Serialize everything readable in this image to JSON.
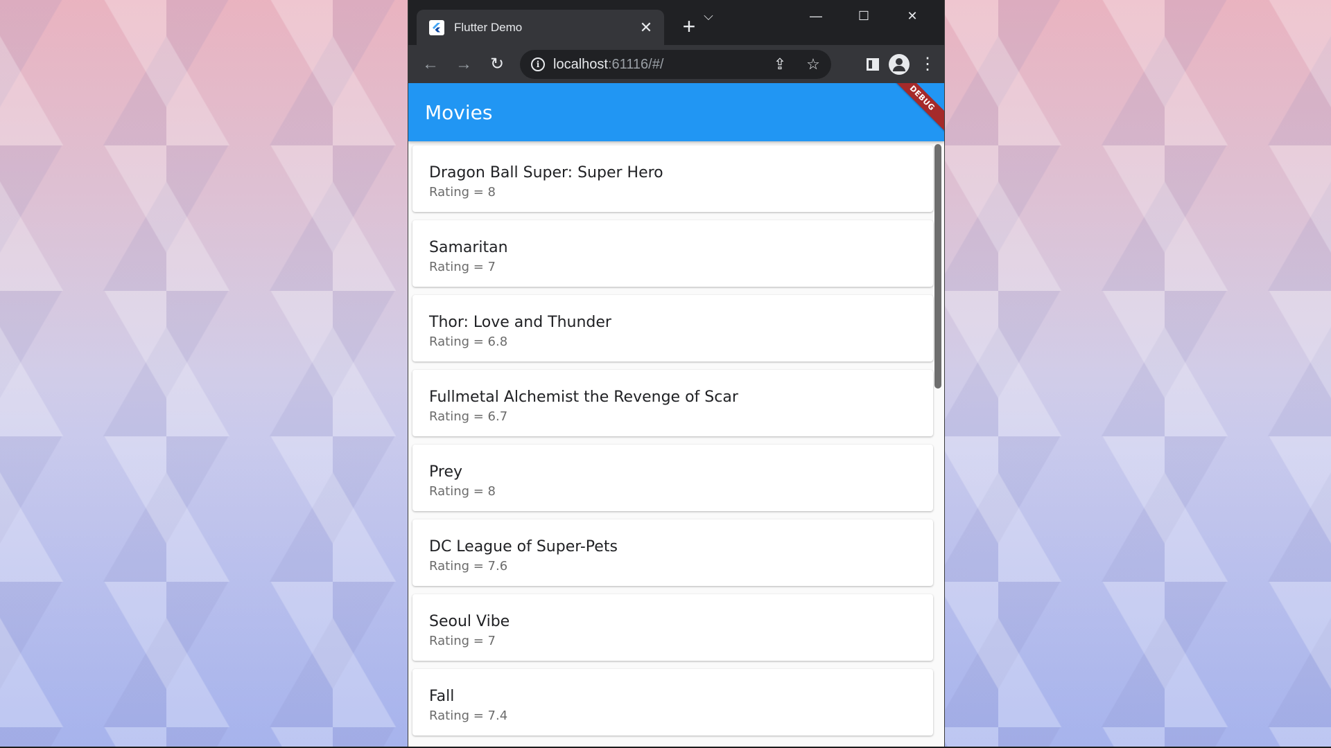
{
  "browser": {
    "tab_title": "Flutter Demo",
    "tab_close": "✕",
    "new_tab": "+",
    "url_host": "localhost",
    "url_rest": ":61116/#/",
    "window_controls": {
      "dropdown": "⌵",
      "minimize": "—",
      "maximize": "☐",
      "close": "✕"
    },
    "nav": {
      "back": "←",
      "forward": "→",
      "reload": "↻"
    }
  },
  "app": {
    "title": "Movies",
    "debug_banner": "DEBUG",
    "accent_color": "#2196f3",
    "movies": [
      {
        "title": "Dragon Ball Super: Super Hero",
        "rating": "Rating = 8"
      },
      {
        "title": "Samaritan",
        "rating": "Rating = 7"
      },
      {
        "title": "Thor: Love and Thunder",
        "rating": "Rating = 6.8"
      },
      {
        "title": "Fullmetal Alchemist the Revenge of Scar",
        "rating": "Rating = 6.7"
      },
      {
        "title": "Prey",
        "rating": "Rating = 8"
      },
      {
        "title": "DC League of Super-Pets",
        "rating": "Rating = 7.6"
      },
      {
        "title": "Seoul Vibe",
        "rating": "Rating = 7"
      },
      {
        "title": "Fall",
        "rating": "Rating = 7.4"
      }
    ]
  }
}
